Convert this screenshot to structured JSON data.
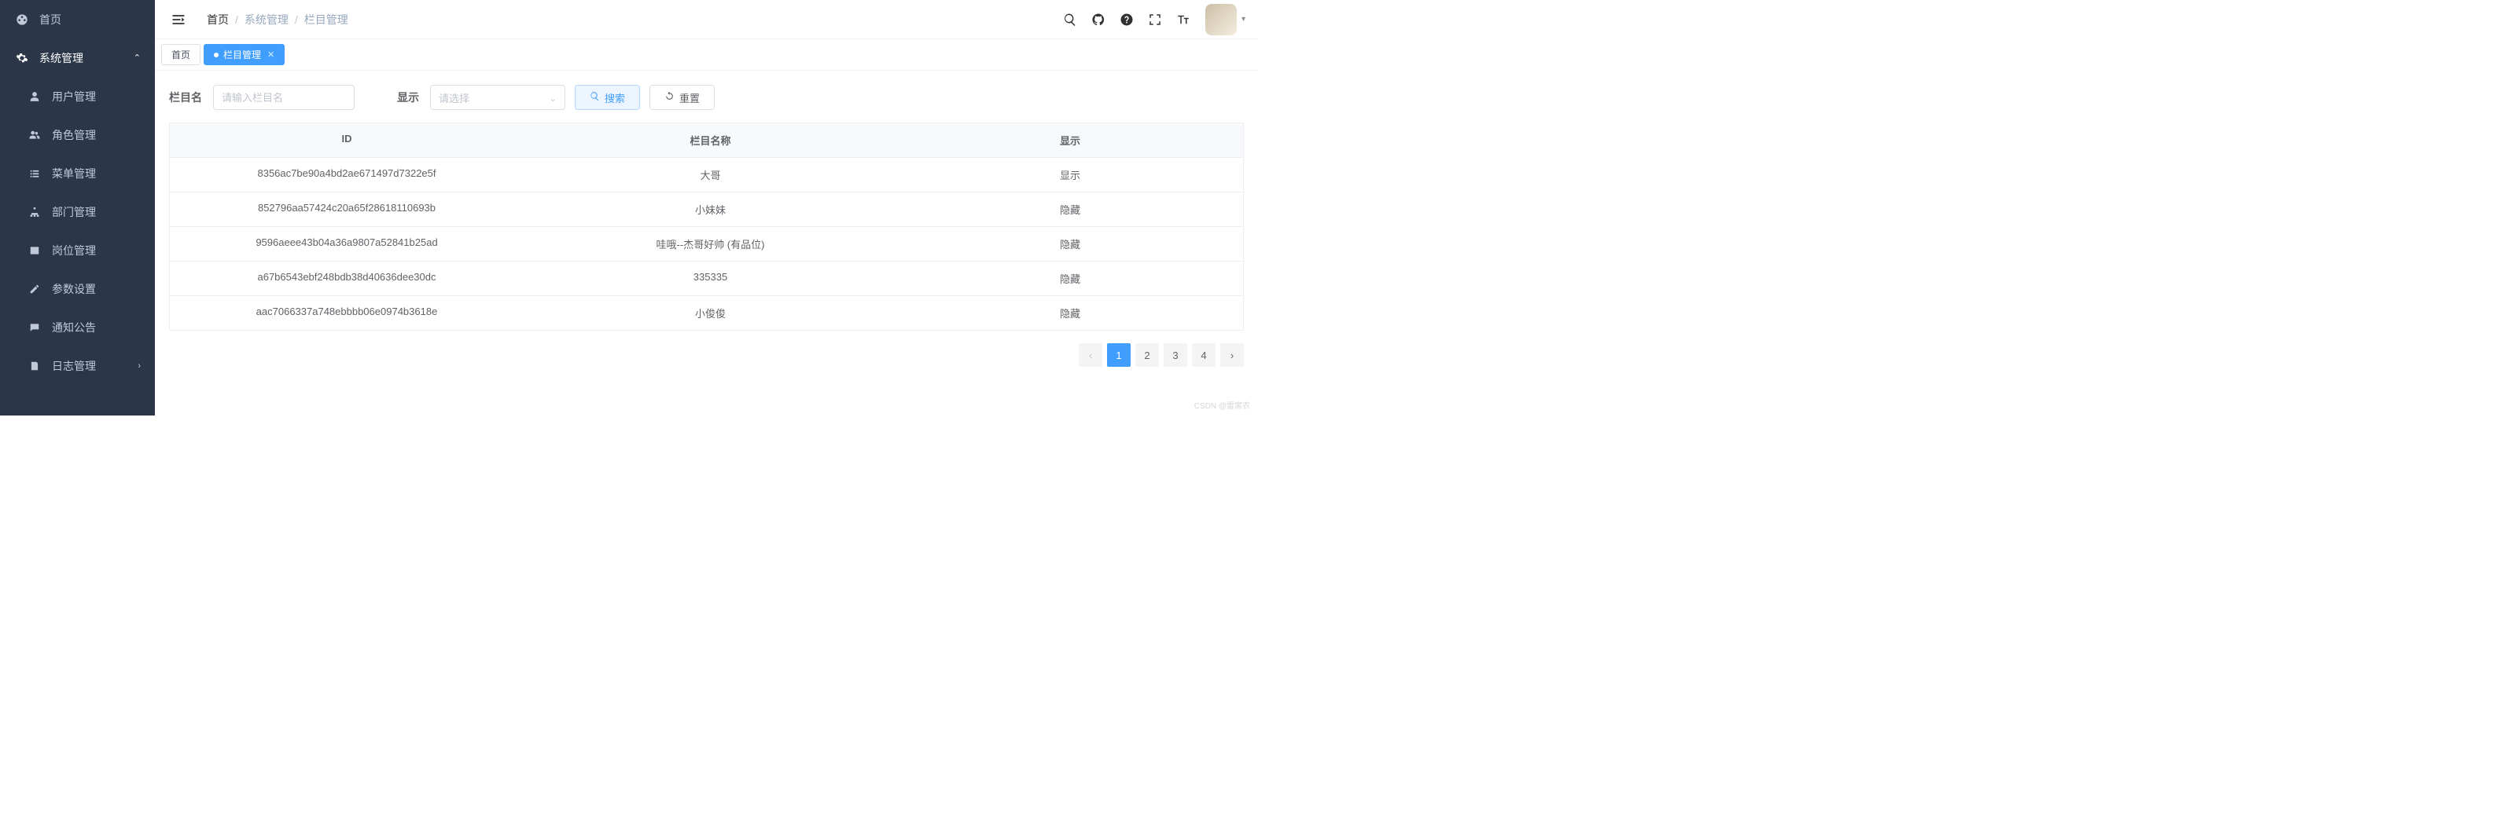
{
  "sidebar": {
    "home": "首页",
    "group": "系统管理",
    "items": [
      {
        "label": "用户管理"
      },
      {
        "label": "角色管理"
      },
      {
        "label": "菜单管理"
      },
      {
        "label": "部门管理"
      },
      {
        "label": "岗位管理"
      },
      {
        "label": "参数设置"
      },
      {
        "label": "通知公告"
      },
      {
        "label": "日志管理"
      }
    ]
  },
  "breadcrumb": {
    "home": "首页",
    "sys": "系统管理",
    "page": "栏目管理"
  },
  "tabs": {
    "home": "首页",
    "active": "栏目管理"
  },
  "toolbar": {
    "name_label": "栏目名",
    "name_placeholder": "请输入栏目名",
    "show_label": "显示",
    "show_placeholder": "请选择",
    "search": "搜索",
    "reset": "重置"
  },
  "table": {
    "headers": {
      "id": "ID",
      "name": "栏目名称",
      "show": "显示"
    },
    "rows": [
      {
        "id": "8356ac7be90a4bd2ae671497d7322e5f",
        "name": "大哥",
        "show": "显示"
      },
      {
        "id": "852796aa57424c20a65f28618110693b",
        "name": "小妹妹",
        "show": "隐藏"
      },
      {
        "id": "9596aeee43b04a36a9807a52841b25ad",
        "name": "哇哦--杰哥好帅 (有品位)",
        "show": "隐藏"
      },
      {
        "id": "a67b6543ebf248bdb38d40636dee30dc",
        "name": "335335",
        "show": "隐藏"
      },
      {
        "id": "aac7066337a748ebbbb06e0974b3618e",
        "name": "小俊俊",
        "show": "隐藏"
      }
    ]
  },
  "pagination": {
    "pages": [
      "1",
      "2",
      "3",
      "4"
    ],
    "current": "1"
  },
  "watermark": "CSDN @雷寓农"
}
